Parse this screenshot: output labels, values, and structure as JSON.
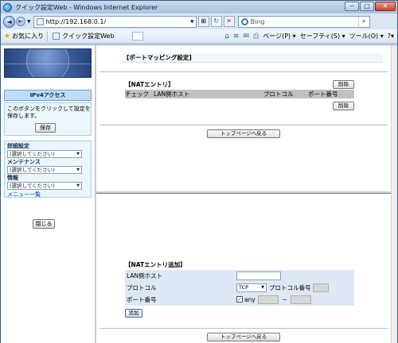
{
  "window": {
    "title": "クイック設定Web - Windows Internet Explorer",
    "minimize": "─",
    "maximize": "□",
    "close": "✕"
  },
  "address": {
    "back": "◄",
    "forward": "►",
    "url": "http://192.168.0.1/",
    "search_placeholder": "Bing",
    "refresh": "↻",
    "stop": "✕"
  },
  "favorites": {
    "favorites_label": "お気に入り",
    "tab_label": "クイック設定Web",
    "commands": [
      "ページ(P) ▾",
      "セーフティ(S) ▾",
      "ツール(O) ▾",
      "?▾"
    ]
  },
  "sidebar": {
    "ipv4_label": "IPv4アクセス",
    "save_text": "このボタンをクリックして設定を保存します。",
    "save_label": "保存",
    "groups": [
      {
        "label": "詳細設定",
        "select": "(選択してください)"
      },
      {
        "label": "メンテナンス",
        "select": "(選択してください)"
      },
      {
        "label": "情報",
        "select": "(選択してください)"
      }
    ],
    "menu_list_label": "メニュー一覧",
    "close_label": "閉じる"
  },
  "top_frame": {
    "title": "[ポートマッピング設定]",
    "nat_heading": "【NATエントリ】",
    "delete_label": "削除",
    "columns": [
      "チェック",
      "LAN側ホスト",
      "プロトコル",
      "ポート番号"
    ],
    "back_label": "トップページへ戻る"
  },
  "bottom_frame": {
    "heading": "【NATエントリ追加】",
    "lan_host_label": "LAN側ホスト",
    "lan_host_value": "",
    "protocol_label": "プロトコル",
    "protocol_value": "TCP",
    "protocol_number_label": "プロトコル番号",
    "port_label": "ポート番号",
    "any_label": "any",
    "any_checked": true,
    "range_sep": "－",
    "add_label": "追加",
    "back_label": "トップページへ戻る"
  }
}
